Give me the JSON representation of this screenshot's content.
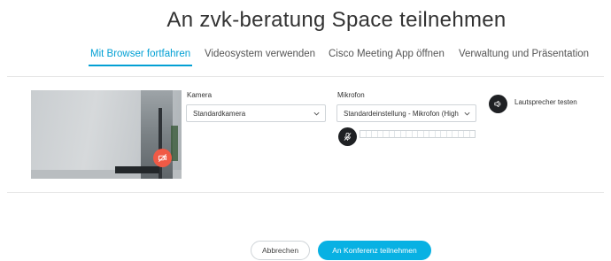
{
  "page": {
    "title": "An zvk-beratung Space teilnehmen"
  },
  "tabs": [
    {
      "label": "Mit Browser fortfahren",
      "active": true
    },
    {
      "label": "Videosystem verwenden",
      "active": false
    },
    {
      "label": "Cisco Meeting App öffnen",
      "active": false
    },
    {
      "label": "Verwaltung und Präsentation",
      "active": false
    }
  ],
  "camera": {
    "label": "Kamera",
    "selected": "Standardkamera",
    "toggle_icon": "camera-off-icon"
  },
  "microphone": {
    "label": "Mikrofon",
    "selected": "Standardeinstellung - Mikrofon (High",
    "mute_icon": "microphone-muted-icon",
    "level": 0
  },
  "speaker": {
    "label": "Lautsprecher testen",
    "icon": "speaker-icon"
  },
  "actions": {
    "cancel_label": "Abbrechen",
    "join_label": "An Konferenz teilnehmen"
  },
  "colors": {
    "accent": "#03a0d4",
    "join_button": "#08b1e3",
    "camera_off": "#f05a46",
    "icon_button": "#1f2124"
  }
}
